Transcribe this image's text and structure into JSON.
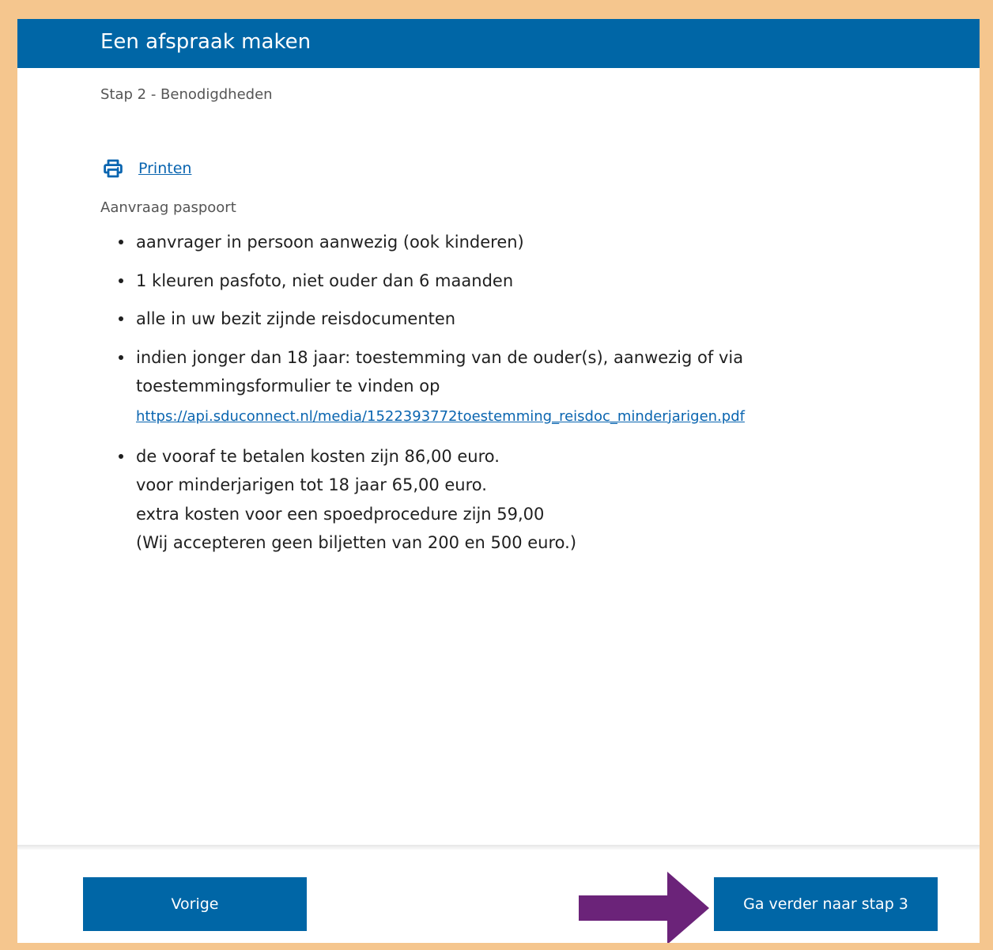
{
  "header": {
    "title": "Een afspraak maken"
  },
  "step_label": "Stap 2 - Benodigdheden",
  "print": {
    "icon": "printer-icon",
    "label": "Printen"
  },
  "section_label": "Aanvraag paspoort",
  "items": [
    {
      "text": "aanvrager in persoon aanwezig (ook kinderen)"
    },
    {
      "text": "1 kleuren pasfoto, niet ouder dan 6 maanden"
    },
    {
      "text": "alle in uw bezit zijnde reisdocumenten"
    },
    {
      "line1": "indien jonger dan 18 jaar: toestemming van de ouder(s), aanwezig of via",
      "line2": "toestemmingsformulier te vinden op",
      "link": "https://api.sduconnect.nl/media/1522393772toestemming_reisdoc_minderjarigen.pdf"
    },
    {
      "lines": [
        "de vooraf te betalen kosten zijn  86,00 euro.",
        "voor minderjarigen tot 18 jaar 65,00 euro.",
        "extra kosten voor een spoedprocedure zijn 59,00",
        "(Wij accepteren geen biljetten van 200 en 500 euro.)"
      ]
    }
  ],
  "footer": {
    "prev_label": "Vorige",
    "next_label": "Ga verder naar stap 3"
  },
  "colors": {
    "page_border": "#f5c68e",
    "brand_blue": "#0066a6",
    "link_blue": "#0a65b0",
    "arrow_purple": "#6b2379"
  }
}
